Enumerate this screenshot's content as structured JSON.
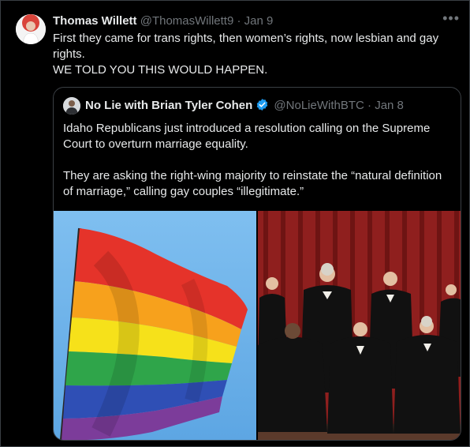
{
  "tweet": {
    "author_name": "Thomas Willett",
    "handle": "@ThomasWillett9",
    "separator": "·",
    "date": "Jan 9",
    "more_label": "•••",
    "text_lines": [
      "First they came for trans rights, then women’s rights, now lesbian and gay",
      "rights.",
      "WE TOLD YOU THIS WOULD HAPPEN."
    ]
  },
  "quoted": {
    "author_name": "No Lie with Brian Tyler Cohen",
    "handle": "@NoLieWithBTC",
    "separator": "·",
    "date": "Jan 8",
    "text_lines": [
      "Idaho Republicans just introduced a resolution calling on the Supreme",
      "Court to overturn marriage equality.",
      "",
      "They are asking the right-wing majority to reinstate the “natural definition",
      "of marriage,” calling gay couples “illegitimate.”"
    ],
    "verified_color": "#1d9bf0",
    "media": [
      {
        "icon": "rainbow-flag-photo"
      },
      {
        "icon": "supreme-court-justices-photo"
      }
    ]
  }
}
